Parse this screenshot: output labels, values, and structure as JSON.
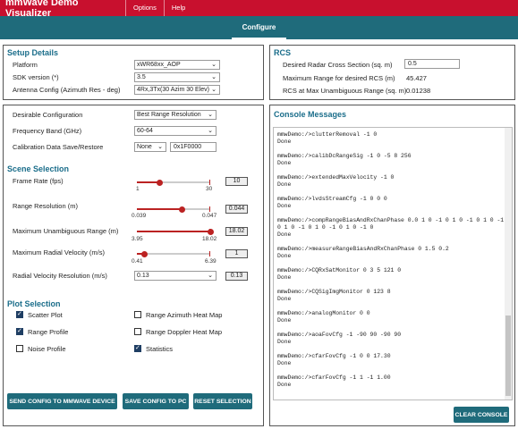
{
  "app": {
    "title": "mmWave Demo Visualizer"
  },
  "menu": {
    "options": "Options",
    "help": "Help"
  },
  "tabs": {
    "configure": "Configure"
  },
  "setup": {
    "title": "Setup Details",
    "platform_label": "Platform",
    "platform_value": "xWR68xx_AOP",
    "sdk_label": "SDK version (*)",
    "sdk_value": "3.5",
    "antenna_label": "Antenna Config (Azimuth Res - deg)",
    "antenna_value": "4Rx,3Tx(30 Azim 30 Elev)"
  },
  "rcs": {
    "title": "RCS",
    "desired_label": "Desired Radar Cross Section (sq. m)",
    "desired_value": "0.5",
    "max_range_label": "Maximum Range for desired RCS (m)",
    "max_range_value": "45.427",
    "rcs_max_label": "RCS at Max Unambiguous Range (sq. m)",
    "rcs_max_value": "0.01238"
  },
  "config": {
    "desirable_label": "Desirable Configuration",
    "desirable_value": "Best Range Resolution",
    "freq_label": "Frequency Band (GHz)",
    "freq_value": "60-64",
    "calib_label": "Calibration Data Save/Restore",
    "calib_mode": "None",
    "calib_addr": "0x1F0000"
  },
  "scene": {
    "title": "Scene Selection",
    "frame_rate": {
      "label": "Frame Rate (fps)",
      "min": "1",
      "max": "30",
      "value": "10",
      "fraction": 0.31
    },
    "range_res": {
      "label": "Range Resolution (m)",
      "min": "0.039",
      "max": "0.047",
      "value": "0.044",
      "fraction": 0.62
    },
    "max_range": {
      "label": "Maximum Unambiguous Range (m)",
      "min": "3.95",
      "max": "18.02",
      "value": "18.02",
      "fraction": 1.0
    },
    "max_vel": {
      "label": "Maximum Radial Velocity (m/s)",
      "min": "0.41",
      "max": "6.39",
      "value": "1",
      "fraction": 0.1
    },
    "vel_res_label": "Radial Velocity Resolution (m/s)",
    "vel_res_select": "0.13",
    "vel_res_value": "0.13"
  },
  "plot": {
    "title": "Plot Selection",
    "scatter": "Scatter Plot",
    "range_profile": "Range Profile",
    "noise_profile": "Noise Profile",
    "range_azimuth": "Range Azimuth Heat Map",
    "range_doppler": "Range Doppler Heat Map",
    "statistics": "Statistics"
  },
  "buttons": {
    "send": "SEND CONFIG TO MMWAVE DEVICE",
    "save": "SAVE CONFIG TO PC",
    "reset": "RESET SELECTION",
    "clear": "CLEAR CONSOLE"
  },
  "console": {
    "title": "Console Messages",
    "lines": [
      "mmwDemo:/>clutterRemoval -1 0",
      "Done",
      "",
      "mmwDemo:/>calibDcRangeSig -1 0 -5 8 256",
      "Done",
      "",
      "mmwDemo:/>extendedMaxVelocity -1 0",
      "Done",
      "",
      "mmwDemo:/>lvdsStreamCfg -1 0 0 0",
      "Done",
      "",
      "mmwDemo:/>compRangeBiasAndRxChanPhase 0.0 1 0 -1 0 1 0 -1 0 1 0 -1",
      "0 1 0 -1 0 1 0 -1 0 1 0 -1 0",
      "Done",
      "",
      "mmwDemo:/>measureRangeBiasAndRxChanPhase 0 1.5 0.2",
      "Done",
      "",
      "mmwDemo:/>CQRxSatMonitor 0 3 5 121 0",
      "Done",
      "",
      "mmwDemo:/>CQSigImgMonitor 0 123 8",
      "Done",
      "",
      "mmwDemo:/>analogMonitor 0 0",
      "Done",
      "",
      "mmwDemo:/>aoaFovCfg -1 -90 90 -90 90",
      "Done",
      "",
      "mmwDemo:/>cfarFovCfg -1 0 0 17.30",
      "Done",
      "",
      "mmwDemo:/>cfarFovCfg -1 1 -1 1.00",
      "Done"
    ]
  }
}
